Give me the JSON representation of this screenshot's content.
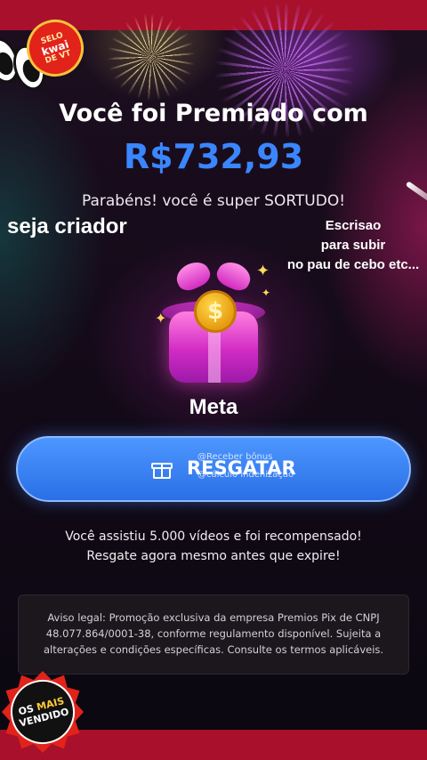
{
  "header": {
    "title": "Você foi Premiado com",
    "amount": "R$732,93",
    "subtitle": "Parabéns! você é super SORTUDO!"
  },
  "overlay": {
    "creator_text": "seja criador",
    "note_line1": "Escrisao",
    "note_line2": "para subir",
    "note_line3": "no pau de cebo etc..."
  },
  "badge": {
    "line1": "SELO",
    "line2": "kwai",
    "line3": "DE VT"
  },
  "gift": {
    "label": "Meta",
    "coin_symbol": "$"
  },
  "button": {
    "label": "RESGATAR",
    "overlay_top": "@Receber bônus",
    "overlay_bottom": "@cálculo indenização",
    "icon": "gift-icon"
  },
  "info": {
    "line1": "Você assistiu 5.000 vídeos e foi recompensado!",
    "line2": "Resgate agora mesmo antes que expire!"
  },
  "legal": {
    "text": "Aviso legal: Promoção exclusiva da empresa Premios Pix de CNPJ 48.077.864/0001-38, conforme regulamento disponível. Sujeita a alterações e condições específicas. Consulte os termos aplicáveis."
  },
  "sticker": {
    "line1_a": "OS ",
    "line1_b": "MAIS",
    "line2": "VENDIDO"
  },
  "colors": {
    "accent_blue": "#3a86ff",
    "button_blue": "#4d97ff",
    "band_red": "#a8102b"
  }
}
